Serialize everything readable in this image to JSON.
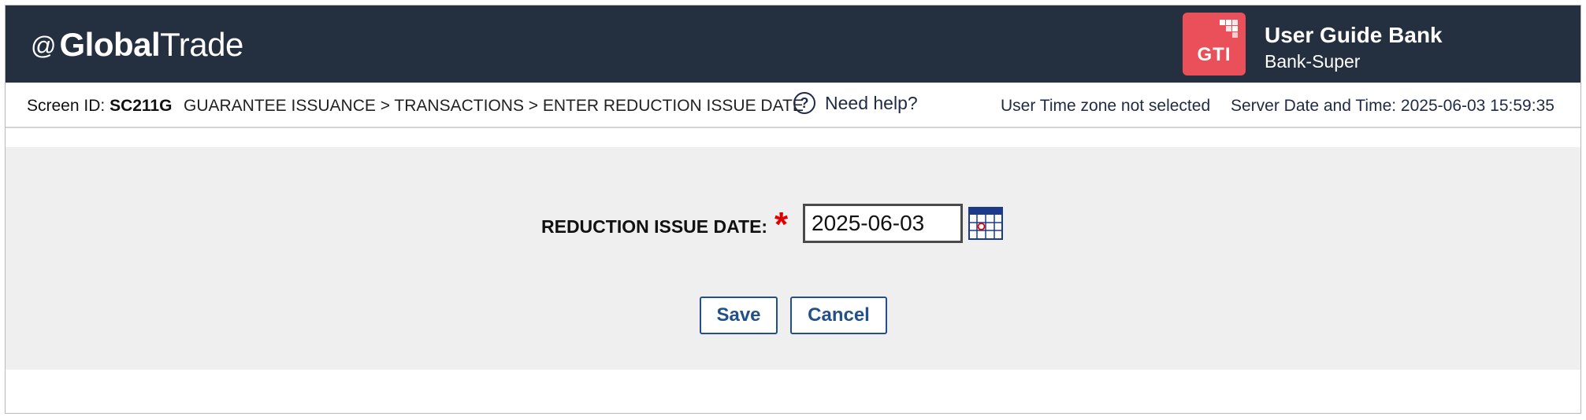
{
  "header": {
    "logo": {
      "at": "@",
      "bold": "Global",
      "light": "Trade"
    },
    "badge_text": "GTI",
    "bank_name": "User Guide Bank",
    "bank_role": "Bank-Super"
  },
  "infobar": {
    "screen_id_label": "Screen ID:",
    "screen_id_value": "SC211G",
    "breadcrumb": "GUARANTEE ISSUANCE > TRANSACTIONS > ENTER REDUCTION ISSUE DATE",
    "help_label": "Need help?",
    "timezone": "User Time zone not selected",
    "server_time": "Server Date and Time: 2025-06-03 15:59:35"
  },
  "form": {
    "field_label": "REDUCTION ISSUE DATE:",
    "required_marker": "*",
    "date_value": "2025-06-03"
  },
  "buttons": {
    "save_label": "Save",
    "cancel_label": "Cancel"
  },
  "colors": {
    "header_bg": "#243040",
    "badge": "#e9505a",
    "accent": "#23508a",
    "required": "#e10000",
    "form_bg": "#efefef"
  }
}
